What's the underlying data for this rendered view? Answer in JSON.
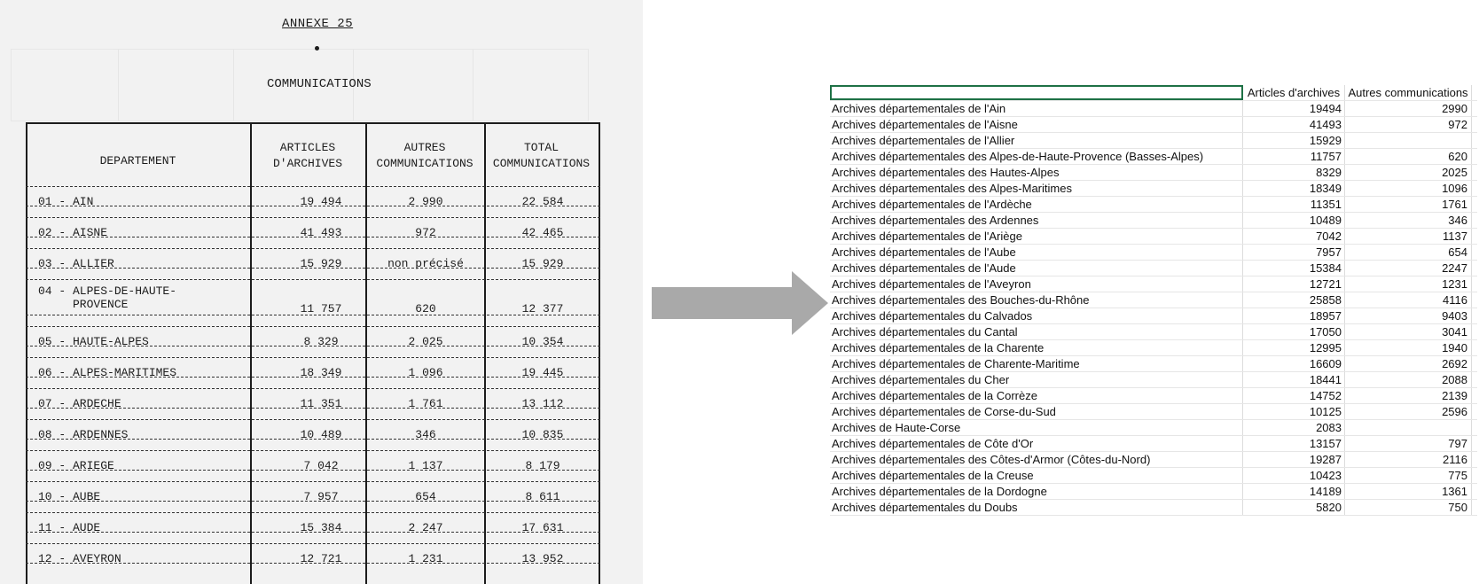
{
  "document": {
    "annexe": "ANNEXE 25",
    "title": "COMMUNICATIONS",
    "headers": {
      "departement": "DEPARTEMENT",
      "articles": "ARTICLES\nD'ARCHIVES",
      "autres": "AUTRES\nCOMMUNICATIONS",
      "total": "TOTAL\nCOMMUNICATIONS"
    },
    "rows": [
      {
        "dep": "01 - AIN",
        "art": "19 494",
        "aut": "2 990",
        "tot": "22 584"
      },
      {
        "dep": "02 - AISNE",
        "art": "41 493",
        "aut": "972",
        "tot": "42 465"
      },
      {
        "dep": "03 - ALLIER",
        "art": "15 929",
        "aut": "non précisé",
        "tot": "15 929"
      },
      {
        "dep": "04 - ALPES-DE-HAUTE-\n     PROVENCE",
        "art": "11 757",
        "aut": "620",
        "tot": "12 377"
      },
      {
        "dep": "05 - HAUTE-ALPES",
        "art": "8 329",
        "aut": "2 025",
        "tot": "10 354"
      },
      {
        "dep": "06 - ALPES-MARITIMES",
        "art": "18 349",
        "aut": "1 096",
        "tot": "19 445"
      },
      {
        "dep": "07 - ARDECHE",
        "art": "11 351",
        "aut": "1 761",
        "tot": "13 112"
      },
      {
        "dep": "08 - ARDENNES",
        "art": "10 489",
        "aut": "346",
        "tot": "10 835"
      },
      {
        "dep": "09 - ARIEGE",
        "art": "7 042",
        "aut": "1 137",
        "tot": "8 179"
      },
      {
        "dep": "10 - AUBE",
        "art": "7 957",
        "aut": "654",
        "tot": "8 611"
      },
      {
        "dep": "11 - AUDE",
        "art": "15 384",
        "aut": "2 247",
        "tot": "17 631"
      },
      {
        "dep": "12 - AVEYRON",
        "art": "12 721",
        "aut": "1 231",
        "tot": "13 952"
      }
    ]
  },
  "spreadsheet": {
    "header": {
      "a": "",
      "b": "Articles d'archives",
      "c": "Autres communications"
    },
    "rows": [
      {
        "a": "Archives départementales de l'Ain",
        "b": "19494",
        "c": "2990"
      },
      {
        "a": "Archives départementales de l'Aisne",
        "b": "41493",
        "c": "972"
      },
      {
        "a": "Archives départementales de l'Allier",
        "b": "15929",
        "c": ""
      },
      {
        "a": "Archives départementales des Alpes-de-Haute-Provence (Basses-Alpes)",
        "b": "11757",
        "c": "620"
      },
      {
        "a": "Archives départementales des Hautes-Alpes",
        "b": "8329",
        "c": "2025"
      },
      {
        "a": "Archives départementales des Alpes-Maritimes",
        "b": "18349",
        "c": "1096"
      },
      {
        "a": "Archives départementales de l'Ardèche",
        "b": "11351",
        "c": "1761"
      },
      {
        "a": "Archives départementales des Ardennes",
        "b": "10489",
        "c": "346"
      },
      {
        "a": "Archives départementales de l'Ariège",
        "b": "7042",
        "c": "1137"
      },
      {
        "a": "Archives départementales de l'Aube",
        "b": "7957",
        "c": "654"
      },
      {
        "a": "Archives départementales de l'Aude",
        "b": "15384",
        "c": "2247"
      },
      {
        "a": "Archives départementales de l'Aveyron",
        "b": "12721",
        "c": "1231"
      },
      {
        "a": "Archives départementales des Bouches-du-Rhône",
        "b": "25858",
        "c": "4116"
      },
      {
        "a": "Archives départementales du Calvados",
        "b": "18957",
        "c": "9403"
      },
      {
        "a": "Archives départementales du Cantal",
        "b": "17050",
        "c": "3041"
      },
      {
        "a": "Archives départementales de la Charente",
        "b": "12995",
        "c": "1940"
      },
      {
        "a": "Archives départementales de Charente-Maritime",
        "b": "16609",
        "c": "2692"
      },
      {
        "a": "Archives départementales du Cher",
        "b": "18441",
        "c": "2088"
      },
      {
        "a": "Archives départementales de la Corrèze",
        "b": "14752",
        "c": "2139"
      },
      {
        "a": "Archives départementales de Corse-du-Sud",
        "b": "10125",
        "c": "2596"
      },
      {
        "a": "Archives de Haute-Corse",
        "b": "2083",
        "c": ""
      },
      {
        "a": "Archives départementales de Côte d'Or",
        "b": "13157",
        "c": "797"
      },
      {
        "a": "Archives départementales des Côtes-d'Armor (Côtes-du-Nord)",
        "b": "19287",
        "c": "2116"
      },
      {
        "a": "Archives départementales de la Creuse",
        "b": "10423",
        "c": "775"
      },
      {
        "a": "Archives départementales de la Dordogne",
        "b": "14189",
        "c": "1361"
      },
      {
        "a": "Archives départementales du Doubs",
        "b": "5820",
        "c": "750"
      }
    ]
  }
}
